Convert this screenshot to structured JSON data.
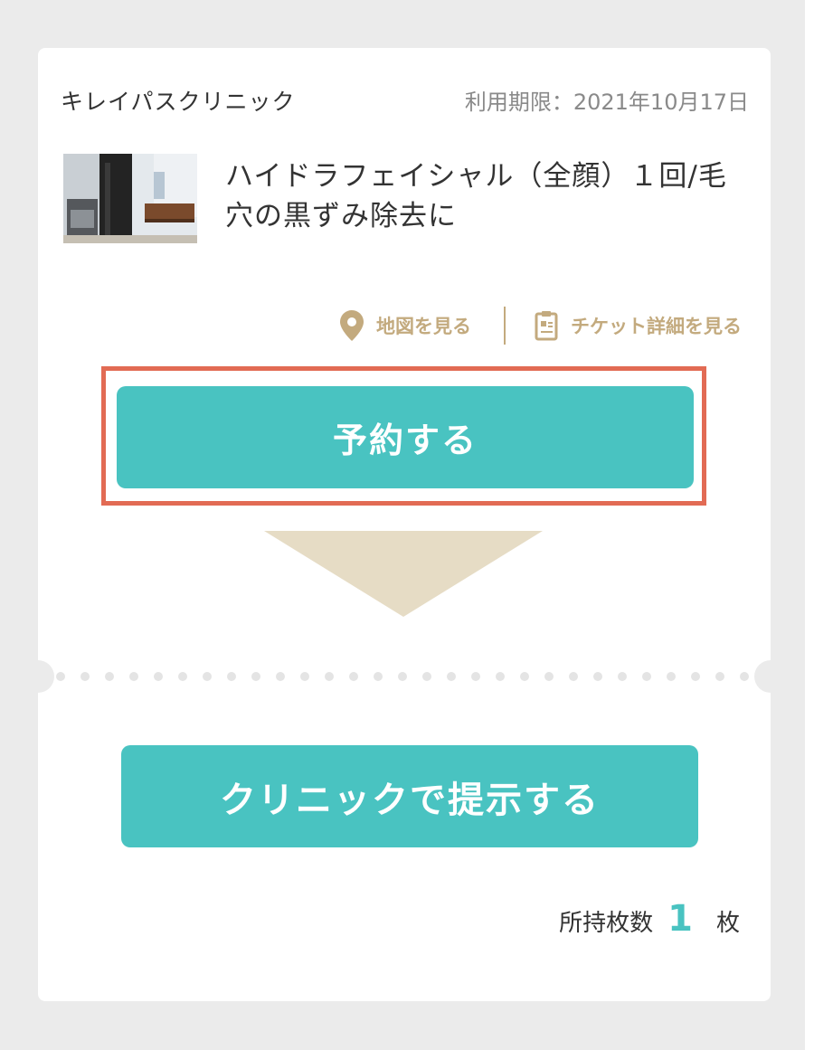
{
  "ticket": {
    "clinic_name": "キレイパスクリニック",
    "expiry": "利用期限：2021年10月17日",
    "product_title": "ハイドラフェイシャル（全顔）１回/毛穴の黒ずみ除去に",
    "thumbnail_icon": "clinic-room-photo",
    "links": {
      "map_label": "地図を見る",
      "map_icon": "map-pin-icon",
      "detail_label": "チケット詳細を見る",
      "detail_icon": "clipboard-icon"
    },
    "reserve_label": "予約する",
    "present_label": "クリニックで提示する",
    "count_prefix": "所持枚数",
    "count_value": "1",
    "count_unit": "枚"
  },
  "colors": {
    "accent": "#49c3c1",
    "gold": "#c3aa7e",
    "highlight": "#e26b54",
    "arrow": "#e6dcc5"
  }
}
